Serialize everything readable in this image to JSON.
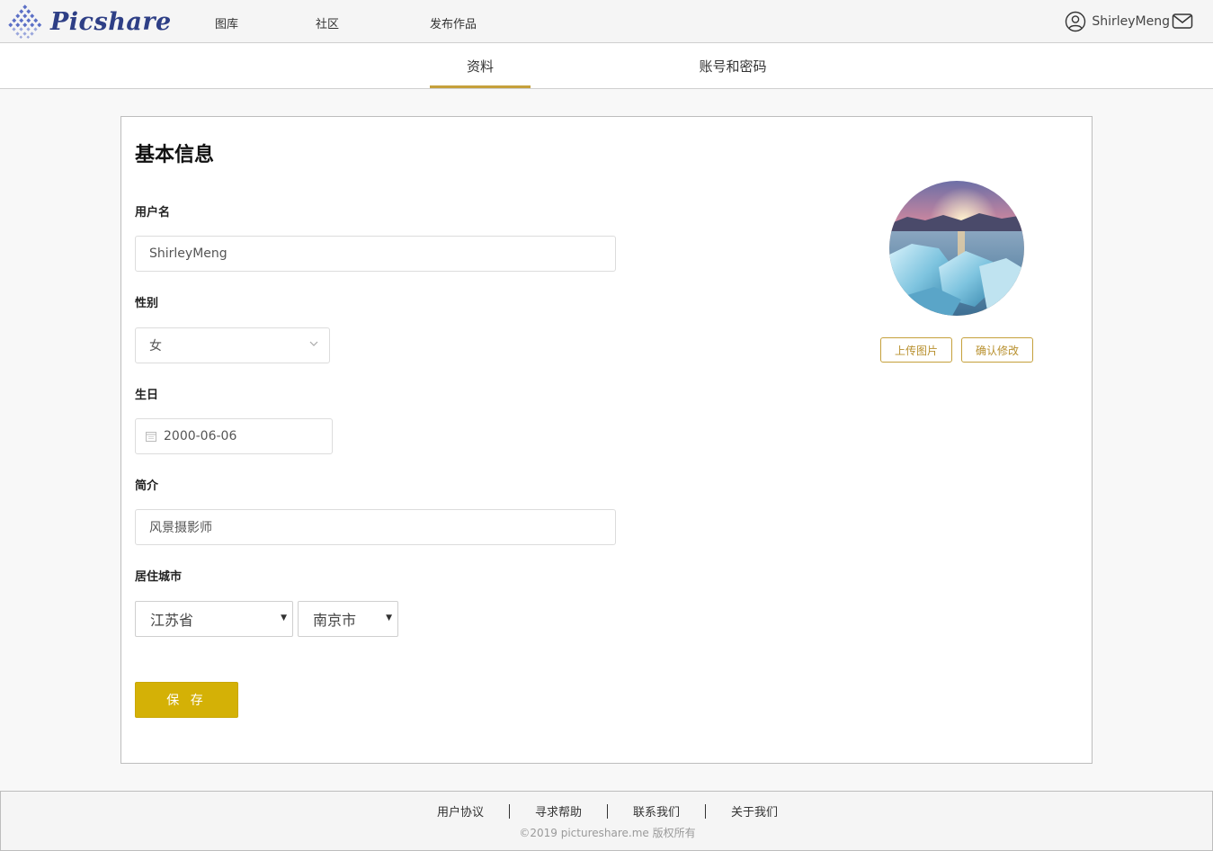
{
  "header": {
    "logo_text": "Picshare",
    "nav": [
      "图库",
      "社区",
      "发布作品"
    ],
    "username": "ShirleyMeng"
  },
  "tabs": [
    {
      "label": "资料",
      "active": true
    },
    {
      "label": "账号和密码",
      "active": false
    }
  ],
  "profile": {
    "title": "基本信息",
    "username_label": "用户名",
    "username_value": "ShirleyMeng",
    "gender_label": "性别",
    "gender_value": "女",
    "birthday_label": "生日",
    "birthday_value": "2000-06-06",
    "bio_label": "简介",
    "bio_value": "风景摄影师",
    "city_label": "居住城市",
    "province_value": "江苏省",
    "city_value": "南京市",
    "save_label": "保 存",
    "upload_label": "上传图片",
    "confirm_label": "确认修改"
  },
  "footer": {
    "links": [
      "用户协议",
      "寻求帮助",
      "联系我们",
      "关于我们"
    ],
    "copyright": "©2019 pictureshare.me 版权所有"
  },
  "colors": {
    "brand": "#2e3f86",
    "accent": "#c5a03b",
    "save_button": "#d4b106"
  },
  "icons": [
    "logo-icon",
    "user-icon",
    "mail-icon",
    "chevron-down-icon",
    "calendar-icon",
    "caret-down-icon"
  ]
}
